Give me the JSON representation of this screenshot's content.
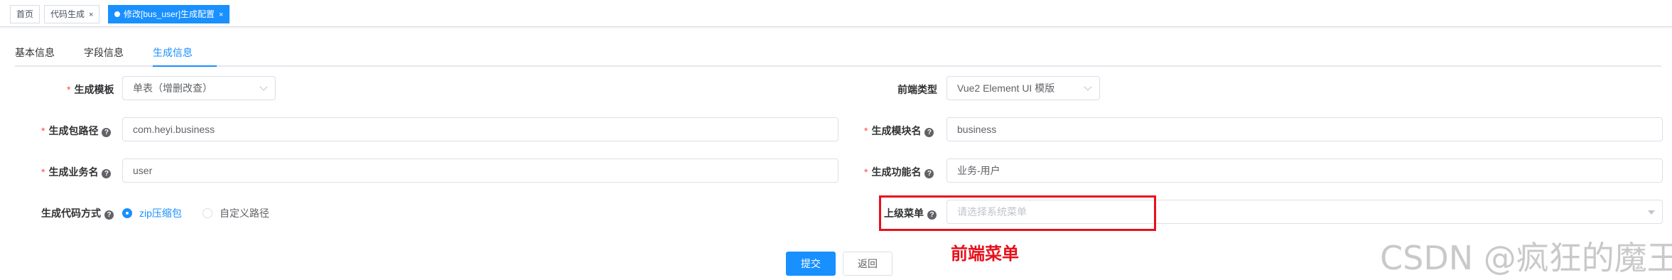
{
  "tags": [
    {
      "label": "首页"
    },
    {
      "label": "代码生成",
      "close": "×"
    },
    {
      "label": "修改[bus_user]生成配置",
      "close": "×"
    }
  ],
  "tabs": [
    "基本信息",
    "字段信息",
    "生成信息"
  ],
  "form": {
    "tpl_category": {
      "label": "生成模板",
      "value": "单表（增删改查）"
    },
    "frontend_type": {
      "label": "前端类型",
      "value": "Vue2 Element UI 模版"
    },
    "package_name": {
      "label": "生成包路径",
      "value": "com.heyi.business"
    },
    "module_name": {
      "label": "生成模块名",
      "value": "business"
    },
    "business_name": {
      "label": "生成业务名",
      "value": "user"
    },
    "function_name": {
      "label": "生成功能名",
      "value": "业务-用户"
    },
    "gen_type": {
      "label": "生成代码方式",
      "options": [
        "zip压缩包",
        "自定义路径"
      ]
    },
    "parent_menu": {
      "label": "上级菜单",
      "placeholder": "请选择系统菜单"
    }
  },
  "help_glyph": "?",
  "required_glyph": "*",
  "annotation": "前端菜单",
  "buttons": {
    "submit": "提交",
    "back": "返回"
  },
  "watermark": "CSDN @疯狂的魔王",
  "colors": {
    "primary": "#1890ff",
    "annotation": "#e8101b",
    "required": "#ff4949"
  }
}
